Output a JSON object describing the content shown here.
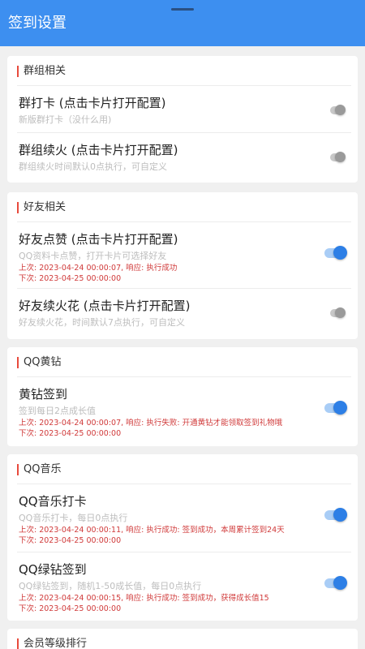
{
  "header": {
    "title": "签到设置"
  },
  "colors": {
    "appbar": "#3d8ff0",
    "section_bar": "#e84a3c",
    "status_text": "#d03a3a",
    "switch_on": "#2d7fe6",
    "switch_off": "#9a9a9a"
  },
  "sections": [
    {
      "title": "群组相关",
      "items": [
        {
          "title": "群打卡 (点击卡片打开配置)",
          "desc": "新版群打卡（没什么用)",
          "enabled": false
        },
        {
          "title": "群组续火 (点击卡片打开配置)",
          "desc": "群组续火时间默认0点执行，可自定义",
          "enabled": false
        }
      ]
    },
    {
      "title": "好友相关",
      "items": [
        {
          "title": "好友点赞 (点击卡片打开配置)",
          "desc": "QQ资料卡点赞，打开卡片可选择好友",
          "last": "上次: 2023-04-24 00:00:07, 响应: 执行成功",
          "next": "下次: 2023-04-25 00:00:00",
          "enabled": true
        },
        {
          "title": "好友续火花 (点击卡片打开配置)",
          "desc": "好友续火花，时间默认7点执行，可自定义",
          "enabled": false
        }
      ]
    },
    {
      "title": "QQ黄钻",
      "items": [
        {
          "title": "黄钻签到",
          "desc": "签到每日2点成长值",
          "last": "上次: 2023-04-24 00:00:07, 响应: 执行失败: 开通黄钻才能领取签到礼物哦",
          "next": "下次: 2023-04-25 00:00:00",
          "enabled": true
        }
      ]
    },
    {
      "title": "QQ音乐",
      "items": [
        {
          "title": "QQ音乐打卡",
          "desc": "QQ音乐打卡，每日0点执行",
          "last": "上次: 2023-04-24 00:00:11, 响应: 执行成功: 签到成功，本周累计签到24天",
          "next": "下次: 2023-04-25 00:00:00",
          "enabled": true
        },
        {
          "title": "QQ绿钻签到",
          "desc": "QQ绿钻签到，随机1-50成长值，每日0点执行",
          "last": "上次: 2023-04-24 00:00:15, 响应: 执行成功: 签到成功，获得成长值15",
          "next": "下次: 2023-04-25 00:00:00",
          "enabled": true
        }
      ]
    },
    {
      "title": "会员等级排行",
      "items": []
    }
  ]
}
